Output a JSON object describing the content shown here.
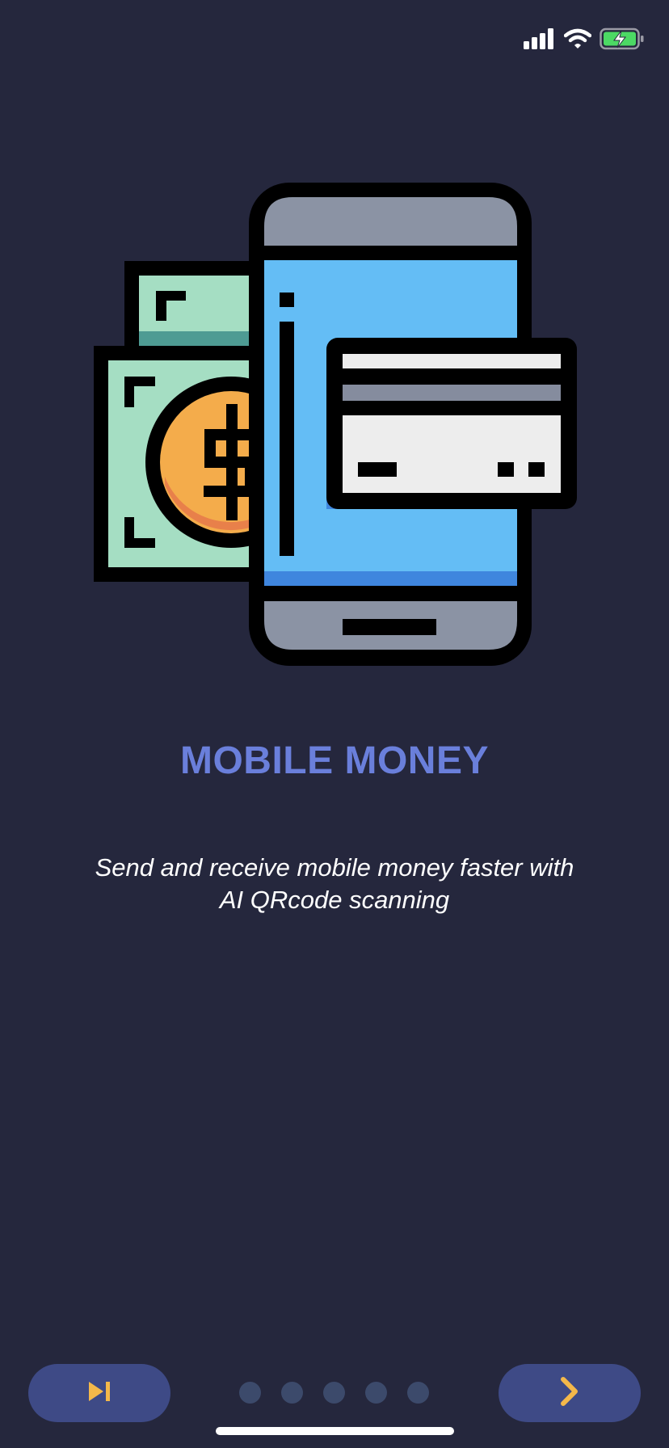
{
  "status_bar": {
    "signal_icon": "cellular-signal-icon",
    "wifi_icon": "wifi-icon",
    "battery_icon": "battery-charging-icon",
    "battery_color": "#4CD964"
  },
  "illustration": {
    "icon": "mobile-money-illustration"
  },
  "onboarding": {
    "title": "MOBILE MONEY",
    "description_line1": "Send and receive mobile money faster with",
    "description_line2": "AI QRcode scanning"
  },
  "navigation": {
    "skip_icon": "skip-forward-icon",
    "next_icon": "chevron-right-icon",
    "page_count": 5,
    "accent_color": "#F4B84A",
    "button_color": "#3E4A86"
  },
  "colors": {
    "background": "#25273D",
    "title": "#6A7FDB"
  }
}
